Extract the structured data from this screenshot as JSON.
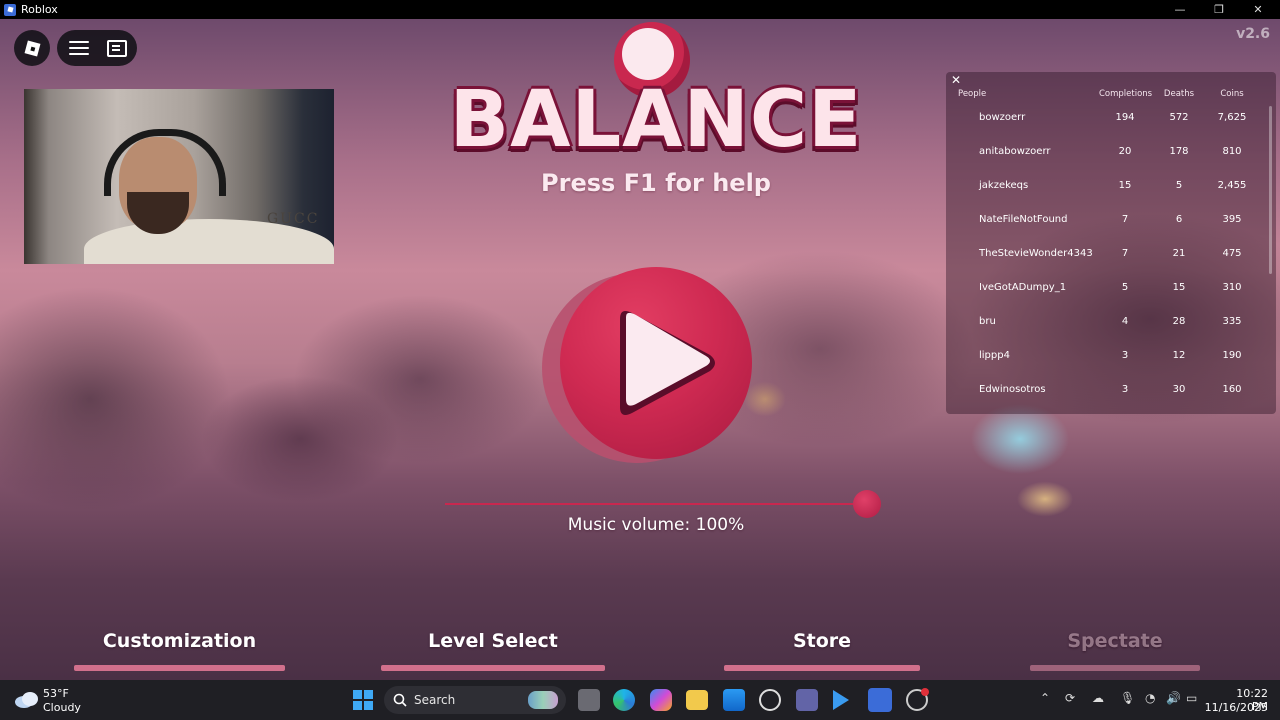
{
  "window": {
    "title": "Roblox",
    "min": "—",
    "max": "❐",
    "close": "✕"
  },
  "game": {
    "version": "v2.6",
    "title": "BALANCE",
    "help_text": "Press F1 for help",
    "music_volume_label": "Music volume: 100%",
    "music_volume": 1.0,
    "menu": [
      {
        "label": "Customization",
        "enabled": true
      },
      {
        "label": "Level Select",
        "enabled": true
      },
      {
        "label": "Store",
        "enabled": true
      },
      {
        "label": "Spectate",
        "enabled": false
      }
    ],
    "webcam_overlay_text": "GUCC"
  },
  "leaderboard": {
    "close": "✕",
    "columns": [
      "People",
      "Completions",
      "Deaths",
      "Coins"
    ],
    "rows": [
      {
        "name": "bowzoerr",
        "completions": "194",
        "deaths": "572",
        "coins": "7,625"
      },
      {
        "name": "anitabowzoerr",
        "completions": "20",
        "deaths": "178",
        "coins": "810"
      },
      {
        "name": "jakzekeqs",
        "completions": "15",
        "deaths": "5",
        "coins": "2,455"
      },
      {
        "name": "NateFileNotFound",
        "completions": "7",
        "deaths": "6",
        "coins": "395"
      },
      {
        "name": "TheStevieWonder4343",
        "completions": "7",
        "deaths": "21",
        "coins": "475"
      },
      {
        "name": "IveGotADumpy_1",
        "completions": "5",
        "deaths": "15",
        "coins": "310"
      },
      {
        "name": "bru",
        "completions": "4",
        "deaths": "28",
        "coins": "335"
      },
      {
        "name": "lippp4",
        "completions": "3",
        "deaths": "12",
        "coins": "190"
      },
      {
        "name": "Edwinosotros",
        "completions": "3",
        "deaths": "30",
        "coins": "160"
      }
    ]
  },
  "taskbar": {
    "weather_temp": "53°F",
    "weather_desc": "Cloudy",
    "search_placeholder": "Search",
    "time": "10:22 PM",
    "date": "11/16/2025",
    "pinned_icons": [
      "windows-start-icon",
      "search-icon",
      "task-view-icon",
      "edge-icon",
      "copilot-icon",
      "file-explorer-icon",
      "store-icon",
      "dell-icon",
      "teams-icon",
      "play-icon",
      "roblox-icon",
      "obs-icon"
    ],
    "tray_icons": [
      "chevron-up-icon",
      "sync-icon",
      "cloud-off-icon",
      "mic-icon",
      "wifi-icon",
      "volume-icon",
      "battery-icon"
    ]
  },
  "colors": {
    "accent": "#c9284f",
    "title_fill": "#fde4ea",
    "title_outline": "#7a1238",
    "menu_bar": "#d1708c"
  }
}
